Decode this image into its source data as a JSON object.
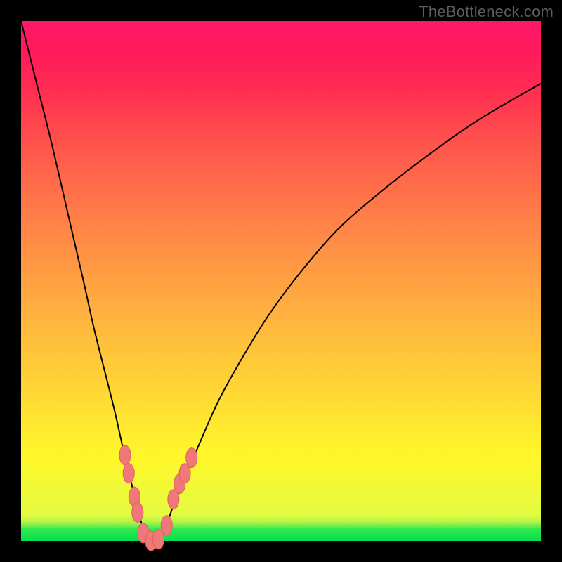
{
  "watermark": "TheBottleneck.com",
  "chart_data": {
    "type": "line",
    "title": "",
    "xlabel": "",
    "ylabel": "",
    "xlim": [
      0,
      100
    ],
    "ylim": [
      0,
      100
    ],
    "grid": false,
    "series": [
      {
        "name": "bottleneck-curve",
        "color": "#000000",
        "x": [
          0,
          3,
          6,
          9,
          12,
          14,
          16,
          18,
          20,
          21,
          22,
          23,
          24,
          25,
          26,
          27,
          28,
          29,
          31,
          34,
          38,
          43,
          48,
          54,
          61,
          69,
          78,
          88,
          100
        ],
        "y": [
          100,
          88,
          76,
          63,
          50,
          41,
          33,
          25,
          16,
          12,
          8,
          4,
          1,
          0,
          0,
          1,
          3,
          6,
          11,
          18,
          27,
          36,
          44,
          52,
          60,
          67,
          74,
          81,
          88
        ]
      }
    ],
    "markers": {
      "name": "highlight-points",
      "color": "#f07878",
      "rx": 8,
      "ry": 14,
      "points": [
        {
          "x": 20.0,
          "y": 16.5
        },
        {
          "x": 20.7,
          "y": 13.0
        },
        {
          "x": 21.8,
          "y": 8.5
        },
        {
          "x": 22.4,
          "y": 5.5
        },
        {
          "x": 23.5,
          "y": 1.5
        },
        {
          "x": 25.0,
          "y": 0.0
        },
        {
          "x": 26.4,
          "y": 0.3
        },
        {
          "x": 28.0,
          "y": 3.0
        },
        {
          "x": 29.3,
          "y": 8.0
        },
        {
          "x": 30.5,
          "y": 11.0
        },
        {
          "x": 31.5,
          "y": 13.0
        },
        {
          "x": 32.8,
          "y": 16.0
        }
      ]
    }
  }
}
